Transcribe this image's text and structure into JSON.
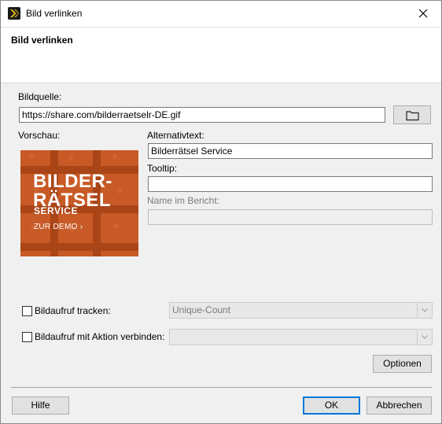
{
  "window": {
    "title": "Bild verlinken",
    "app_icon": "app-logo-icon",
    "close_icon": "close-icon"
  },
  "header": {
    "title": "Bild verlinken"
  },
  "source": {
    "label": "Bildquelle:",
    "value": "https://share.com/bilderraetselr-DE.gif",
    "browse_icon": "folder-icon"
  },
  "preview": {
    "label": "Vorschau:",
    "image_text": {
      "line1": "BILDER-",
      "line2": "RÄTSEL",
      "line3": "SERVICE",
      "cta": "ZUR DEMO ›"
    },
    "colors": {
      "background": "#c75a26",
      "pattern": "#a94516"
    }
  },
  "fields": {
    "alt_label": "Alternativtext:",
    "alt_value": "Bilderrätsel Service",
    "tooltip_label": "Tooltip:",
    "tooltip_value": "",
    "report_name_label": "Name im Bericht:",
    "report_name_value": ""
  },
  "tracking": {
    "track_label": "Bildaufruf tracken:",
    "track_checked": false,
    "track_select_value": "Unique-Count",
    "action_label": "Bildaufruf mit Aktion verbinden:",
    "action_checked": false,
    "action_select_value": ""
  },
  "buttons": {
    "options": "Optionen",
    "help": "Hilfe",
    "ok": "OK",
    "cancel": "Abbrechen"
  },
  "colors": {
    "accent": "#0078d7",
    "button_bg": "#e1e1e1",
    "dialog_bg": "#f0f0f0"
  }
}
